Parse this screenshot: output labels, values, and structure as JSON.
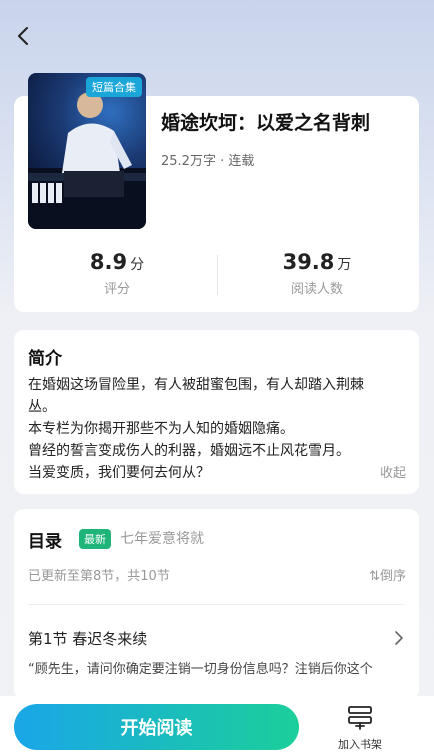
{
  "book": {
    "cover_badge": "短篇合集",
    "title": "婚途坎坷：以爱之名背刺",
    "meta": "25.2万字 · 连载",
    "rating_value": "8.9",
    "rating_unit": "分",
    "rating_label": "评分",
    "readers_value": "39.8",
    "readers_unit": "万",
    "readers_label": "阅读人数"
  },
  "intro": {
    "heading": "简介",
    "lines": [
      "在婚姻这场冒险里，有人被甜蜜包围，有人却踏入荆棘丛。",
      "本专栏为你揭开那些不为人知的婚姻隐痛。",
      "曾经的誓言变成伤人的利器，婚姻远不止风花雪月。",
      "当爱变质，我们要何去何从？"
    ],
    "collapse_label": "收起"
  },
  "toc": {
    "heading": "目录",
    "new_badge": "最新",
    "latest_chapter": "七年爱意将就",
    "updated_text": "已更新至第8节，共10节",
    "sort_label": "倒序",
    "sort_icon": "⇅",
    "chapter": {
      "name": "第1节 春迟冬来续",
      "excerpt": "“顾先生，请问你确定要注销一切身份信息吗？注销后你这个"
    }
  },
  "actions": {
    "start_reading": "开始阅读",
    "add_to_shelf": "加入书架"
  },
  "colors": {
    "accent_start": "#1aa6e8",
    "accent_end": "#1bcf9a",
    "new_badge": "#1fb57a",
    "cover_badge": "#1aa6d9"
  }
}
